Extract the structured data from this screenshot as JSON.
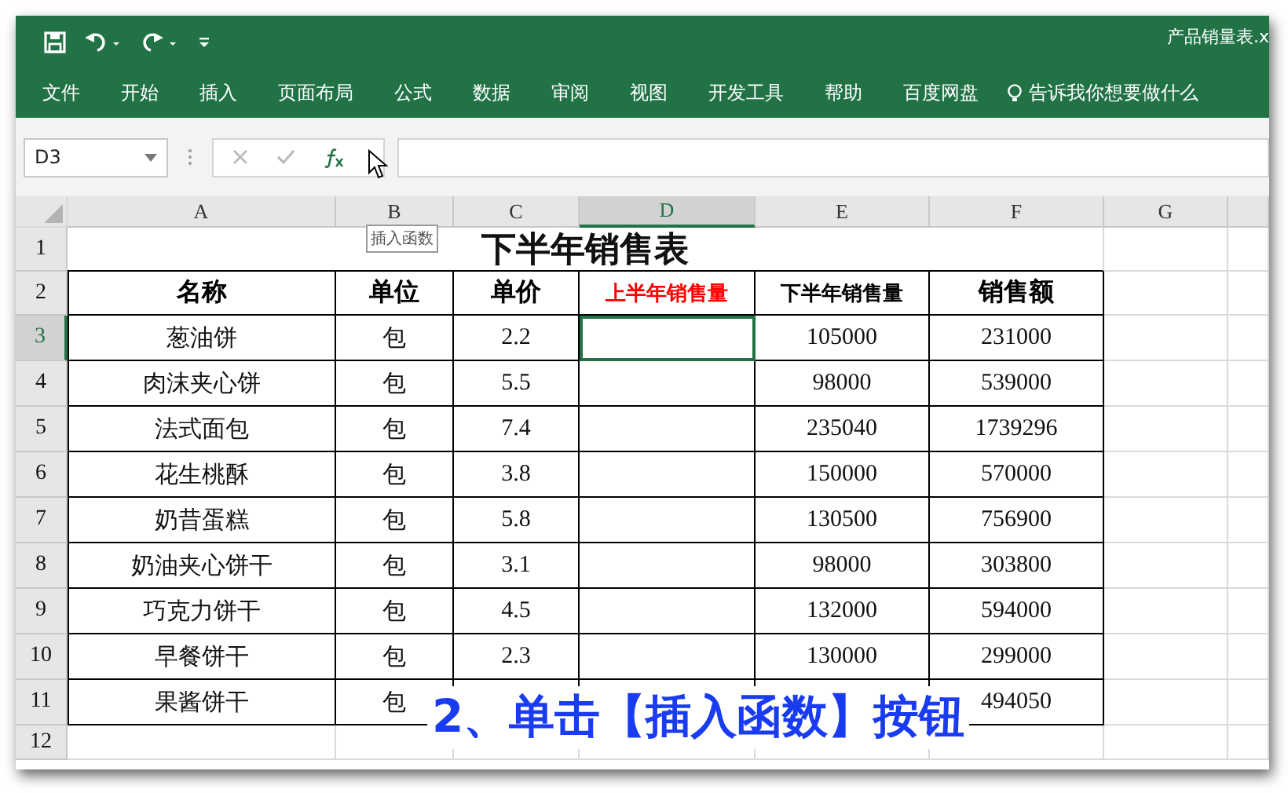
{
  "window": {
    "title": "产品销量表.x"
  },
  "menu": [
    "文件",
    "开始",
    "插入",
    "页面布局",
    "公式",
    "数据",
    "审阅",
    "视图",
    "开发工具",
    "帮助",
    "百度网盘"
  ],
  "tell_me": {
    "placeholder": "告诉我你想要做什么"
  },
  "formula_bar": {
    "name_box": "D3",
    "tooltip": "插入函数"
  },
  "sheet": {
    "columns": [
      {
        "label": "A",
        "selected": false
      },
      {
        "label": "B",
        "selected": false
      },
      {
        "label": "C",
        "selected": false
      },
      {
        "label": "D",
        "selected": true
      },
      {
        "label": "E",
        "selected": false
      },
      {
        "label": "F",
        "selected": false
      },
      {
        "label": "G",
        "selected": false
      }
    ],
    "title_row": {
      "number": "1",
      "selected": false,
      "text": "下半年销售表"
    },
    "header_row": {
      "number": "2",
      "selected": false,
      "cells": [
        {
          "text": "名称",
          "color": "#000000"
        },
        {
          "text": "单位",
          "color": "#000000"
        },
        {
          "text": "单价",
          "color": "#000000"
        },
        {
          "text": "上半年销售量",
          "color": "#ff0000"
        },
        {
          "text": "下半年销售量",
          "color": "#000000"
        },
        {
          "text": "销售额",
          "color": "#000000"
        }
      ]
    },
    "rows": [
      {
        "number": "3",
        "selected": true,
        "cells": [
          "葱油饼",
          "包",
          "2.2",
          null,
          "105000",
          "231000"
        ]
      },
      {
        "number": "4",
        "selected": false,
        "cells": [
          "肉沫夹心饼",
          "包",
          "5.5",
          null,
          "98000",
          "539000"
        ]
      },
      {
        "number": "5",
        "selected": false,
        "cells": [
          "法式面包",
          "包",
          "7.4",
          null,
          "235040",
          "1739296"
        ]
      },
      {
        "number": "6",
        "selected": false,
        "cells": [
          "花生桃酥",
          "包",
          "3.8",
          null,
          "150000",
          "570000"
        ]
      },
      {
        "number": "7",
        "selected": false,
        "cells": [
          "奶昔蛋糕",
          "包",
          "5.8",
          null,
          "130500",
          "756900"
        ]
      },
      {
        "number": "8",
        "selected": false,
        "cells": [
          "奶油夹心饼干",
          "包",
          "3.1",
          null,
          "98000",
          "303800"
        ]
      },
      {
        "number": "9",
        "selected": false,
        "cells": [
          "巧克力饼干",
          "包",
          "4.5",
          null,
          "132000",
          "594000"
        ]
      },
      {
        "number": "10",
        "selected": false,
        "cells": [
          "早餐饼干",
          "包",
          "2.3",
          null,
          "130000",
          "299000"
        ]
      },
      {
        "number": "11",
        "selected": false,
        "cells": [
          "果酱饼干",
          "包",
          null,
          null,
          null,
          "494050"
        ]
      }
    ],
    "empty_rows": [
      {
        "number": "12",
        "selected": false
      }
    ]
  },
  "caption": "2、单击【插入函数】按钮"
}
